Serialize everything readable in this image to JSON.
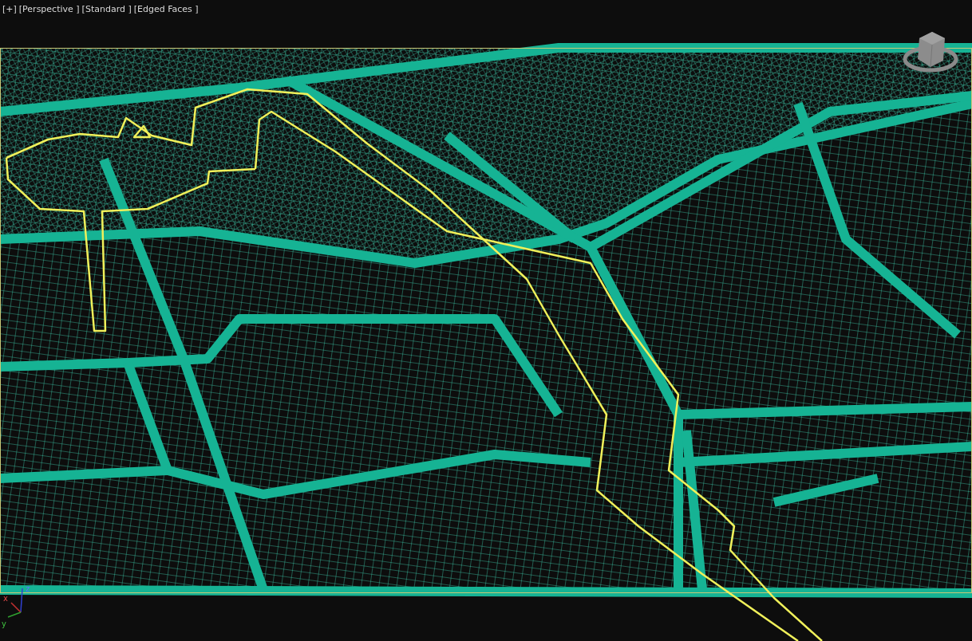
{
  "viewport": {
    "labels": [
      "[+]",
      "[Perspective ]",
      "[Standard ]",
      "[Edged Faces ]"
    ],
    "axis_tripod": [
      "x",
      "y",
      "z"
    ]
  }
}
